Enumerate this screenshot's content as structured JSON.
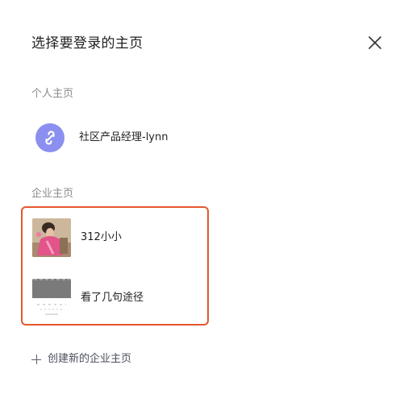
{
  "dialog": {
    "title": "选择要登录的主页"
  },
  "personal": {
    "section_label": "个人主页",
    "name": "社区产品经理-lynn",
    "avatar_icon": "link-chain-icon",
    "avatar_color": "#8a8ff0"
  },
  "company": {
    "section_label": "企业主页",
    "highlight_color": "#e4572e",
    "items": [
      {
        "name": "312小小",
        "avatar": "photo-thumbnail"
      },
      {
        "name": "看了几句途径",
        "avatar": "blurred-thumbnail"
      }
    ]
  },
  "create": {
    "label": "创建新的企业主页",
    "icon": "plus-icon"
  }
}
